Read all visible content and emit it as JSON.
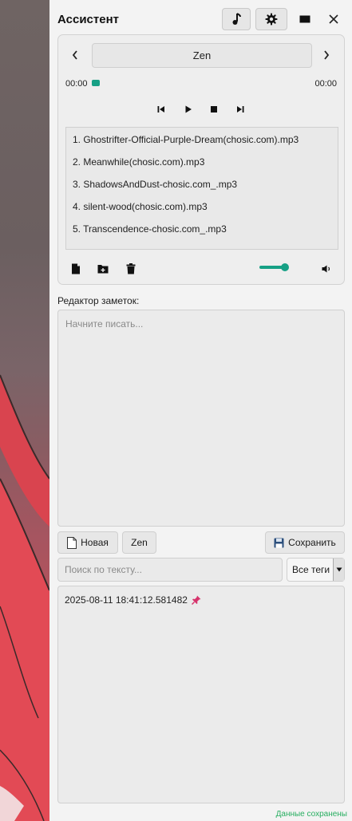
{
  "header": {
    "title": "Ассистент",
    "music_icon": "music-note-icon",
    "settings_icon": "gear-icon",
    "minimize_icon": "window-icon",
    "close_icon": "close-icon"
  },
  "player": {
    "preset": "Zen",
    "time_current": "00:00",
    "time_total": "00:00",
    "tracks": [
      "1. Ghostrifter-Official-Purple-Dream(chosic.com).mp3",
      "2. Meanwhile(chosic.com).mp3",
      "3. ShadowsAndDust-chosic.com_.mp3",
      "4. silent-wood(chosic.com).mp3",
      "5. Transcendence-chosic.com_.mp3"
    ],
    "volume_percent": 85,
    "accent_color": "#16a085"
  },
  "notes": {
    "label": "Редактор заметок:",
    "placeholder": "Начните писать...",
    "new_button": "Новая",
    "zen_button": "Zen",
    "save_button": "Сохранить",
    "search_placeholder": "Поиск по тексту...",
    "tags_selected": "Все теги",
    "items": [
      {
        "timestamp": "2025-08-11 18:41:12.581482",
        "pinned": true
      }
    ]
  },
  "status": "Данные сохранены"
}
